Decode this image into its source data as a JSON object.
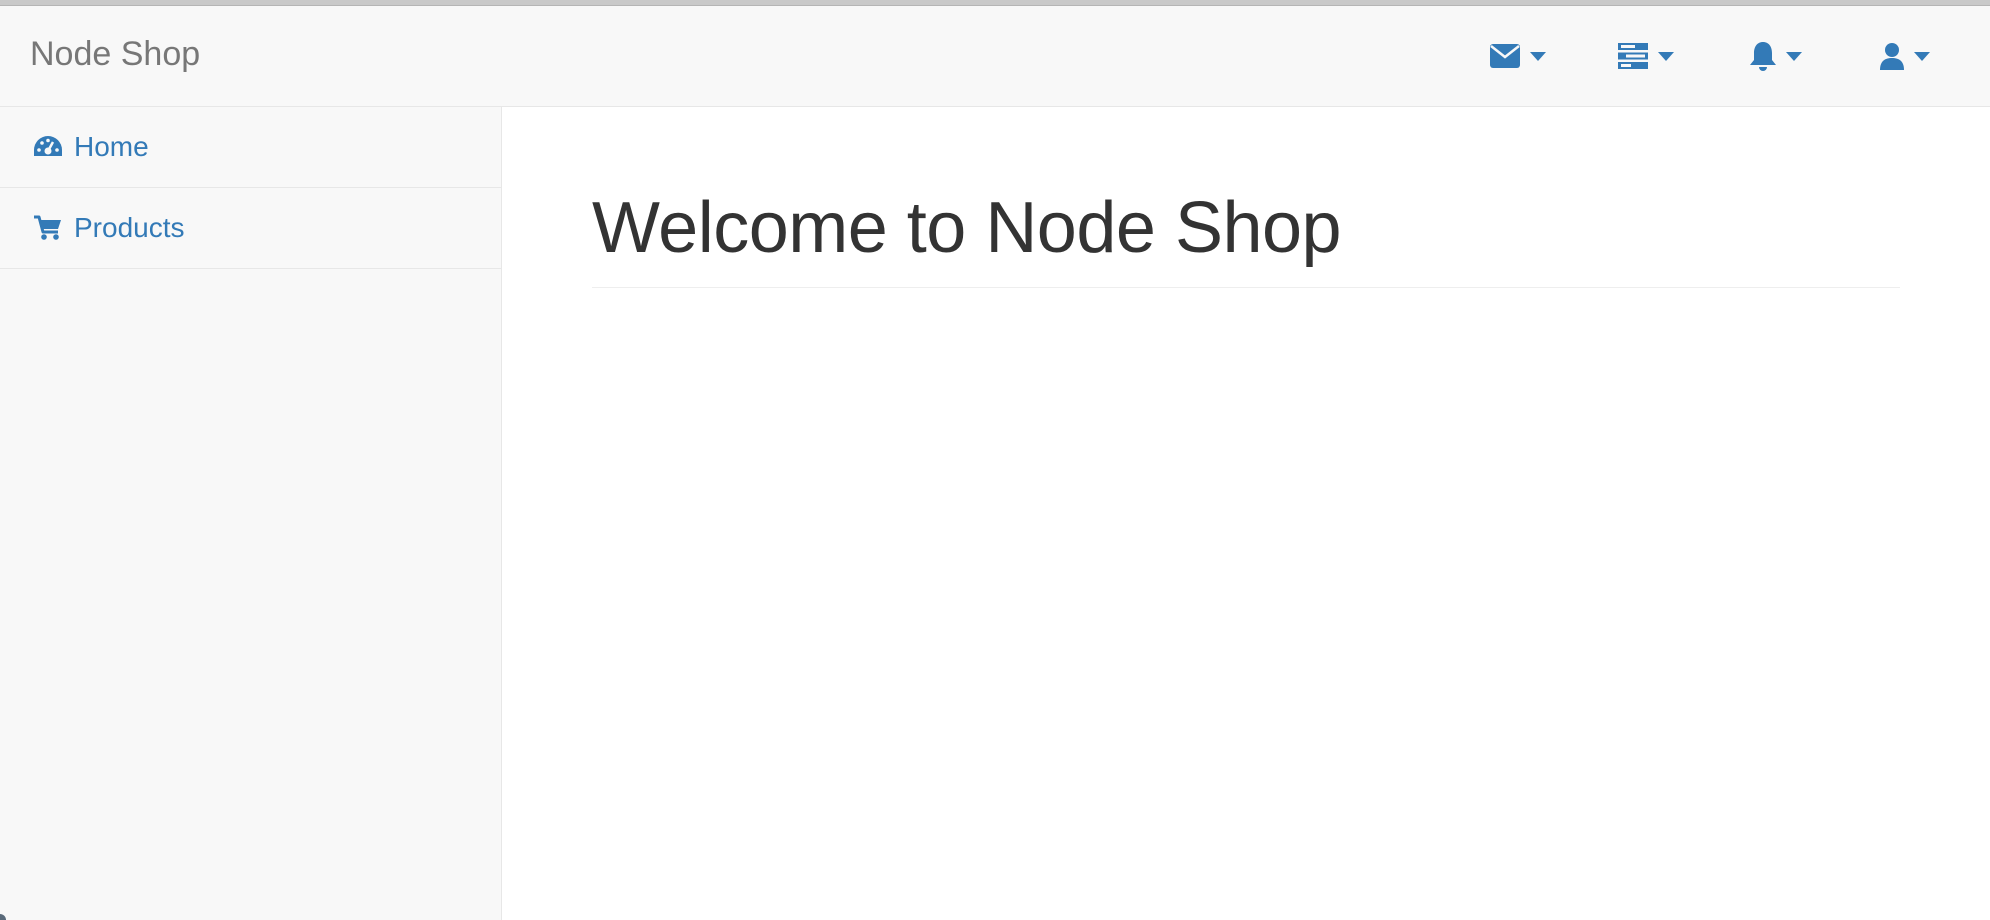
{
  "navbar": {
    "brand": "Node Shop",
    "accent_color": "#337ab7",
    "dropdowns": [
      {
        "icon": "envelope-icon"
      },
      {
        "icon": "tasks-icon"
      },
      {
        "icon": "bell-icon"
      },
      {
        "icon": "user-icon"
      }
    ]
  },
  "sidebar": {
    "items": [
      {
        "label": "Home",
        "icon": "dashboard-icon"
      },
      {
        "label": "Products",
        "icon": "shopping-cart-icon"
      }
    ]
  },
  "main": {
    "title": "Welcome to Node Shop"
  }
}
